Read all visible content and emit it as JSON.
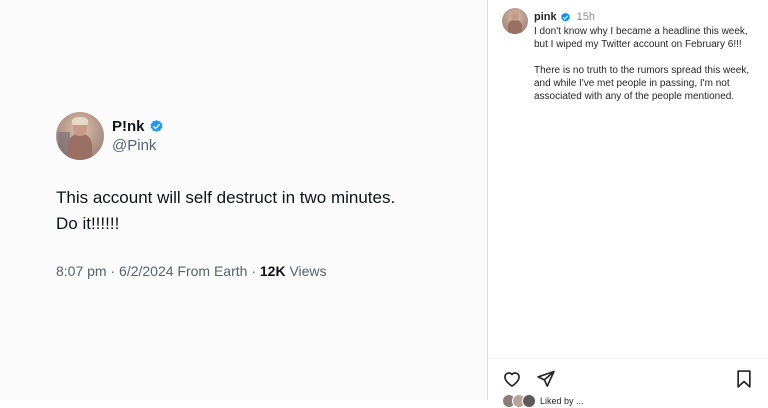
{
  "tweet": {
    "display_name": "P!nk",
    "handle": "@Pink",
    "text_line1": "This account will self destruct in two minutes.",
    "text_line2": "Do it!!!!!!",
    "time_date": "8:07 pm · 6/2/2024 From Earth · ",
    "views_count": "12K",
    "views_label": " Views",
    "verified_color": "#1d9bf0"
  },
  "instagram": {
    "username": "pink",
    "time_ago": "15h",
    "caption_p1": "I don't know why I became a headline this week, but I wiped my Twitter account on February 6!!!",
    "caption_p2": "There is no truth to the rumors spread this week, and while I've met people in passing, I'm not associated with any of the people mentioned.",
    "actions": [
      "heart-icon",
      "send-icon",
      "bookmark-icon"
    ],
    "likes_text": "Liked by ..."
  }
}
